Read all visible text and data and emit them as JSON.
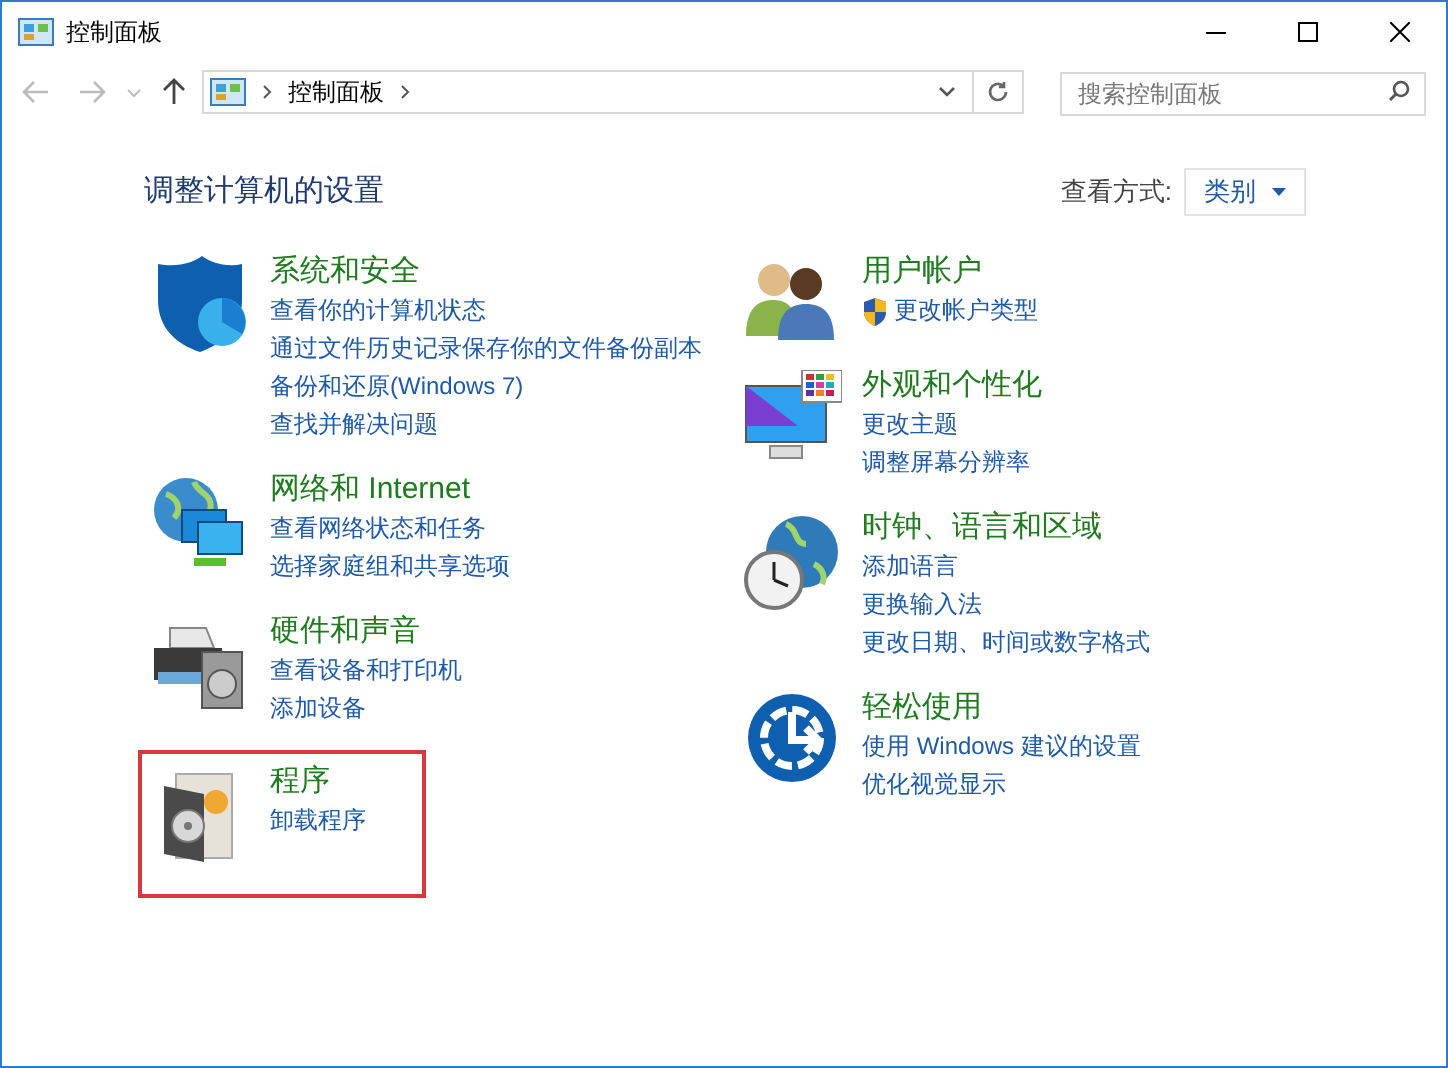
{
  "window": {
    "title": "控制面板"
  },
  "address_bar": {
    "path": [
      "控制面板"
    ]
  },
  "search": {
    "placeholder": "搜索控制面板"
  },
  "heading": "调整计算机的设置",
  "view_by": {
    "label": "查看方式:",
    "value": "类别"
  },
  "columns": [
    [
      {
        "kind": "security",
        "title": "系统和安全",
        "highlighted": false,
        "links": [
          {
            "text": "查看你的计算机状态",
            "shield": false
          },
          {
            "text": "通过文件历史记录保存你的文件备份副本",
            "shield": false
          },
          {
            "text": "备份和还原(Windows 7)",
            "shield": false
          },
          {
            "text": "查找并解决问题",
            "shield": false
          }
        ]
      },
      {
        "kind": "network",
        "title": "网络和 Internet",
        "highlighted": false,
        "links": [
          {
            "text": "查看网络状态和任务",
            "shield": false
          },
          {
            "text": "选择家庭组和共享选项",
            "shield": false
          }
        ]
      },
      {
        "kind": "hardware",
        "title": "硬件和声音",
        "highlighted": false,
        "links": [
          {
            "text": "查看设备和打印机",
            "shield": false
          },
          {
            "text": "添加设备",
            "shield": false
          }
        ]
      },
      {
        "kind": "programs",
        "title": "程序",
        "highlighted": true,
        "links": [
          {
            "text": "卸载程序",
            "shield": false
          }
        ]
      }
    ],
    [
      {
        "kind": "users",
        "title": "用户帐户",
        "highlighted": false,
        "links": [
          {
            "text": "更改帐户类型",
            "shield": true
          }
        ]
      },
      {
        "kind": "appearance",
        "title": "外观和个性化",
        "highlighted": false,
        "links": [
          {
            "text": "更改主题",
            "shield": false
          },
          {
            "text": "调整屏幕分辨率",
            "shield": false
          }
        ]
      },
      {
        "kind": "clock",
        "title": "时钟、语言和区域",
        "highlighted": false,
        "links": [
          {
            "text": "添加语言",
            "shield": false
          },
          {
            "text": "更换输入法",
            "shield": false
          },
          {
            "text": "更改日期、时间或数字格式",
            "shield": false
          }
        ]
      },
      {
        "kind": "ease",
        "title": "轻松使用",
        "highlighted": false,
        "links": [
          {
            "text": "使用 Windows 建议的设置",
            "shield": false
          },
          {
            "text": "优化视觉显示",
            "shield": false
          }
        ]
      }
    ]
  ]
}
